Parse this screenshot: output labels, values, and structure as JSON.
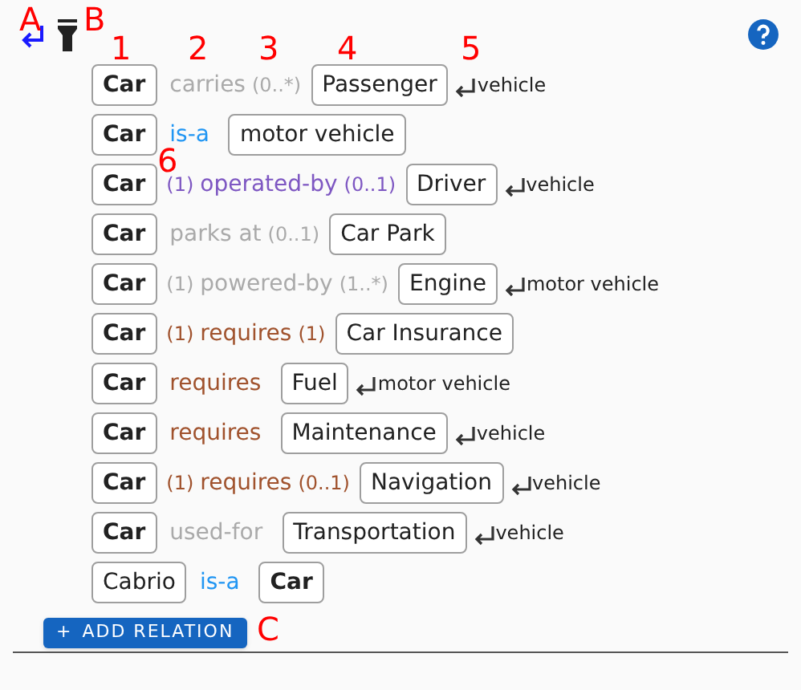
{
  "toolbar": {
    "annotations": [
      {
        "label": "A"
      },
      {
        "label": "B"
      }
    ]
  },
  "relations": [
    {
      "subject": {
        "text": "Car",
        "bold": true
      },
      "relation": {
        "text": "carries",
        "color": "#aaaaaa"
      },
      "card_to": "(0..*)",
      "object": {
        "text": "Passenger",
        "bold": false
      },
      "inherited_from": "vehicle"
    },
    {
      "subject": {
        "text": "Car",
        "bold": true
      },
      "relation": {
        "text": "is-a",
        "color": "#2196f3"
      },
      "object": {
        "text": "motor vehicle",
        "bold": false
      }
    },
    {
      "subject": {
        "text": "Car",
        "bold": true
      },
      "card_from": "(1)",
      "relation": {
        "text": "operated-by",
        "color": "#7e57c2"
      },
      "card_to": "(0..1)",
      "object": {
        "text": "Driver",
        "bold": false
      },
      "inherited_from": "vehicle"
    },
    {
      "subject": {
        "text": "Car",
        "bold": true
      },
      "relation": {
        "text": "parks at",
        "color": "#aaaaaa"
      },
      "card_to": "(0..1)",
      "object": {
        "text": "Car Park",
        "bold": false
      }
    },
    {
      "subject": {
        "text": "Car",
        "bold": true
      },
      "card_from": "(1)",
      "relation": {
        "text": "powered-by",
        "color": "#aaaaaa"
      },
      "card_to": "(1..*)",
      "object": {
        "text": "Engine",
        "bold": false
      },
      "inherited_from": "motor vehicle"
    },
    {
      "subject": {
        "text": "Car",
        "bold": true
      },
      "card_from": "(1)",
      "relation": {
        "text": "requires",
        "color": "#a0522d"
      },
      "card_to": "(1)",
      "object": {
        "text": "Car Insurance",
        "bold": false
      }
    },
    {
      "subject": {
        "text": "Car",
        "bold": true
      },
      "relation": {
        "text": "requires",
        "color": "#a0522d"
      },
      "object": {
        "text": "Fuel",
        "bold": false
      },
      "inherited_from": "motor vehicle"
    },
    {
      "subject": {
        "text": "Car",
        "bold": true
      },
      "relation": {
        "text": "requires",
        "color": "#a0522d"
      },
      "object": {
        "text": "Maintenance",
        "bold": false
      },
      "inherited_from": "vehicle"
    },
    {
      "subject": {
        "text": "Car",
        "bold": true
      },
      "card_from": "(1)",
      "relation": {
        "text": "requires",
        "color": "#a0522d"
      },
      "card_to": "(0..1)",
      "object": {
        "text": "Navigation",
        "bold": false
      },
      "inherited_from": "vehicle"
    },
    {
      "subject": {
        "text": "Car",
        "bold": true
      },
      "relation": {
        "text": "used-for",
        "color": "#aaaaaa"
      },
      "object": {
        "text": "Transportation",
        "bold": false
      },
      "inherited_from": "vehicle"
    },
    {
      "subject": {
        "text": "Cabrio",
        "bold": false
      },
      "relation": {
        "text": "is-a",
        "color": "#2196f3"
      },
      "object": {
        "text": "Car",
        "bold": true
      }
    }
  ],
  "column_annotations": [
    {
      "label": "1"
    },
    {
      "label": "2"
    },
    {
      "label": "3"
    },
    {
      "label": "4"
    },
    {
      "label": "5"
    },
    {
      "label": "6"
    }
  ],
  "add_button": {
    "icon": "+",
    "label": "ADD RELATION",
    "annotation": "C"
  }
}
